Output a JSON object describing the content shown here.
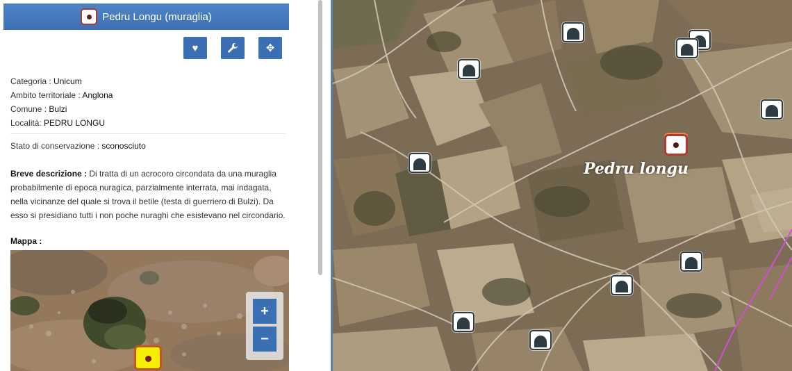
{
  "panel": {
    "title": "Pedru Longu (muraglia)",
    "actions": [
      {
        "name": "favorite",
        "icon": "heart-icon",
        "glyph": "♥"
      },
      {
        "name": "tools",
        "icon": "wrench-icon",
        "glyph": "🔧"
      },
      {
        "name": "locate",
        "icon": "crosshair-icon",
        "glyph": "✥"
      }
    ],
    "fields": [
      {
        "label": "Categoria : ",
        "value": "Unicum"
      },
      {
        "label": "Ambito territoriale : ",
        "value": "Anglona"
      },
      {
        "label": "Comune : ",
        "value": "Bulzi"
      },
      {
        "label": "Località: ",
        "value": "PEDRU LONGU"
      }
    ],
    "conservation": {
      "label": "Stato di conservazione : ",
      "value": "sconosciuto"
    },
    "description": {
      "label": "Breve descrizione : ",
      "text": "Di tratta di un acrocoro circondata da una muraglia probabilmente di epoca nuragica, parzialmente interrata, mai indagata, nella vicinanze del quale si trova il betile (testa di guerriero di Bulzi). Da esso si presidiano tutti i non poche nuraghi che esistevano nel circondario."
    },
    "map_label": "Mappa :",
    "zoom": {
      "in": "+",
      "out": "−"
    }
  },
  "main_map": {
    "place_label": "Pedru longu",
    "marker_icon": "site-marker-icon",
    "nuraghe_icon": "nuraghe-icon",
    "colors": {
      "header": "#3c70b4",
      "button": "#3a70b3",
      "marker_border": "#b23a2f",
      "boundary_line": "#d14fd1"
    }
  }
}
